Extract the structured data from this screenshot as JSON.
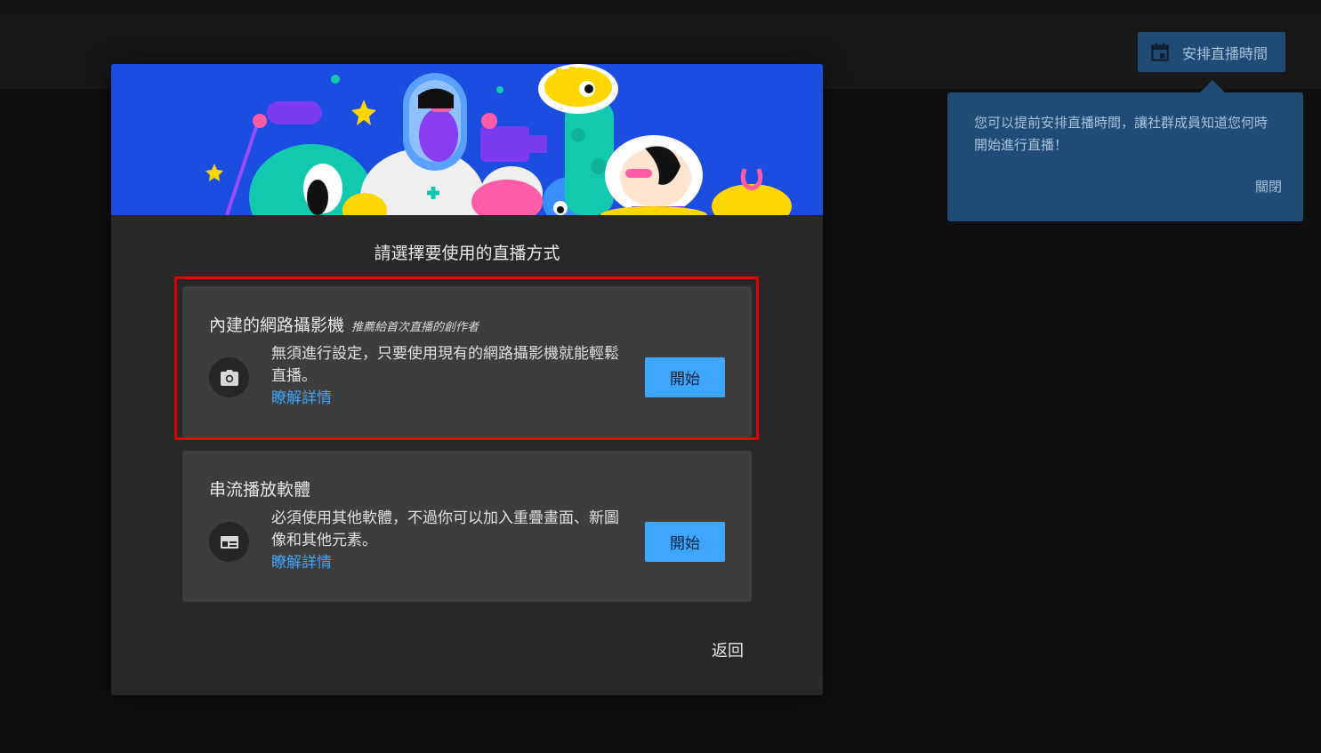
{
  "header": {
    "schedule_button_label": "安排直播時間",
    "schedule_icon": "calendar-icon"
  },
  "tooltip": {
    "text": "您可以提前安排直播時間，讓社群成員知道您何時開始進行直播！",
    "close_label": "關閉"
  },
  "modal": {
    "title": "請選擇要使用的直播方式",
    "back_label": "返回",
    "options": [
      {
        "title": "內建的網路攝影機",
        "subtitle": "推薦給首次直播的創作者",
        "description": "無須進行設定，只要使用現有的網路攝影機就能輕鬆直播。",
        "link": "瞭解詳情",
        "button": "開始",
        "icon": "camera-icon",
        "highlighted": true
      },
      {
        "title": "串流播放軟體",
        "subtitle": "",
        "description": "必須使用其他軟體，不過你可以加入重疊畫面、新圖像和其他元素。",
        "link": "瞭解詳情",
        "button": "開始",
        "icon": "layout-icon",
        "highlighted": false
      }
    ]
  },
  "colors": {
    "accent": "#3ea6ff",
    "tooltip_bg": "#1f4b74",
    "banner_bg": "#1a4de0",
    "highlight_border": "#e00000"
  }
}
